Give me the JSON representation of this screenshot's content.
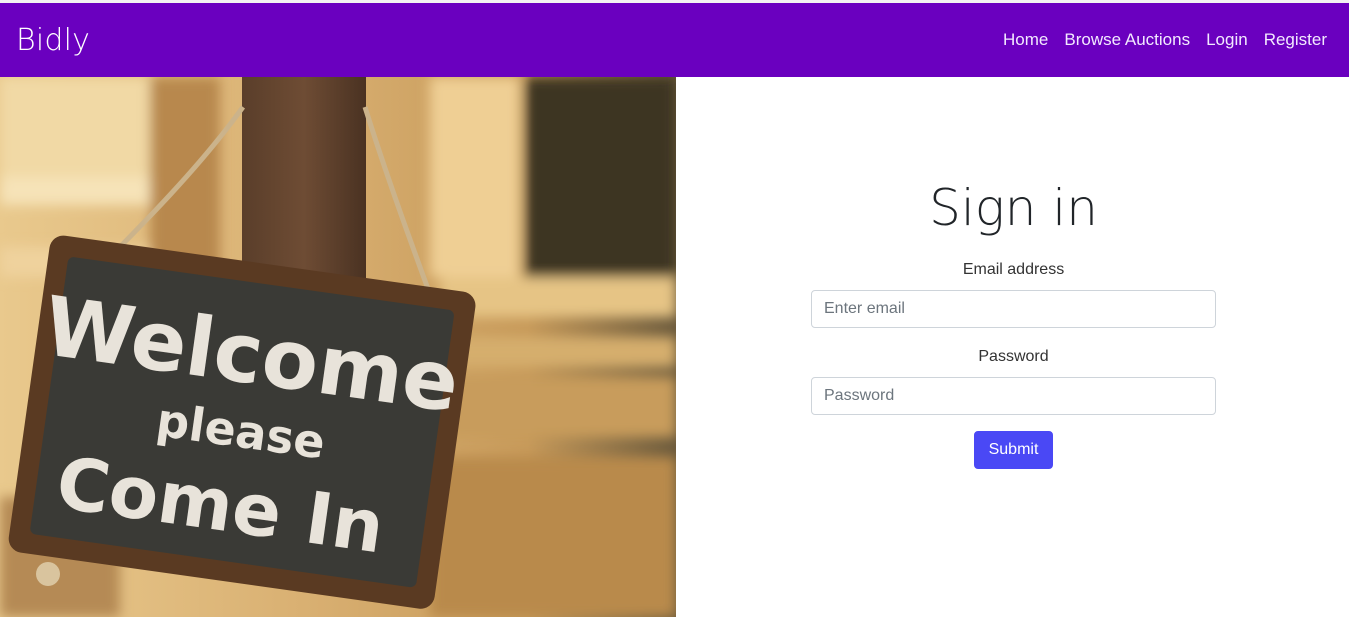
{
  "navbar": {
    "brand": "Bidly",
    "links": [
      "Home",
      "Browse Auctions",
      "Login",
      "Register"
    ],
    "background": "#6a00bf"
  },
  "hero": {
    "sign_text": [
      "Welcome",
      "please",
      "Come In"
    ]
  },
  "form": {
    "title": "Sign in",
    "email_label": "Email address",
    "email_placeholder": "Enter email",
    "password_label": "Password",
    "password_placeholder": "Password",
    "submit_label": "Submit",
    "accent": "#4a48f5"
  }
}
